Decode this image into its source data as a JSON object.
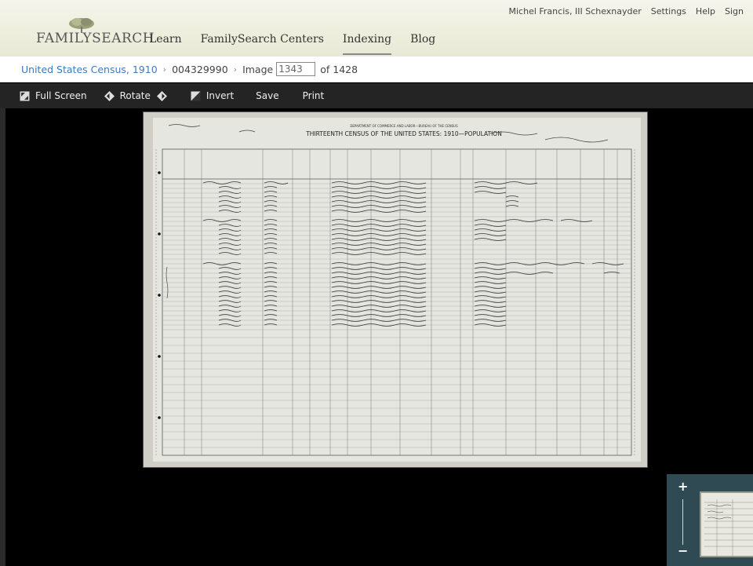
{
  "header": {
    "brand": "FAMILYSEARCH",
    "nav": [
      "Learn",
      "FamilySearch Centers",
      "Indexing",
      "Blog"
    ],
    "active_nav": "Indexing",
    "user": [
      "Michel Francis, III Schexnayder",
      "Settings",
      "Help",
      "Sign"
    ]
  },
  "breadcrumb": {
    "collection": "United States Census, 1910",
    "film": "004329990",
    "image_label": "Image",
    "image_number": "1343",
    "of_label": "of 1428"
  },
  "toolbar": {
    "full_screen": "Full Screen",
    "rotate": "Rotate",
    "invert": "Invert",
    "save": "Save",
    "print": "Print"
  },
  "document": {
    "title_line1": "DEPARTMENT OF COMMERCE AND LABOR—BUREAU OF THE CENSUS",
    "title_line2": "THIRTEENTH CENSUS OF THE UNITED STATES: 1910—POPULATION"
  },
  "minimap": {
    "zoom_in": "+",
    "zoom_out": "−"
  },
  "colors": {
    "link": "#3b7bbf",
    "toolbar_bg": "#242424",
    "minimap_bg": "#2f4a52"
  }
}
